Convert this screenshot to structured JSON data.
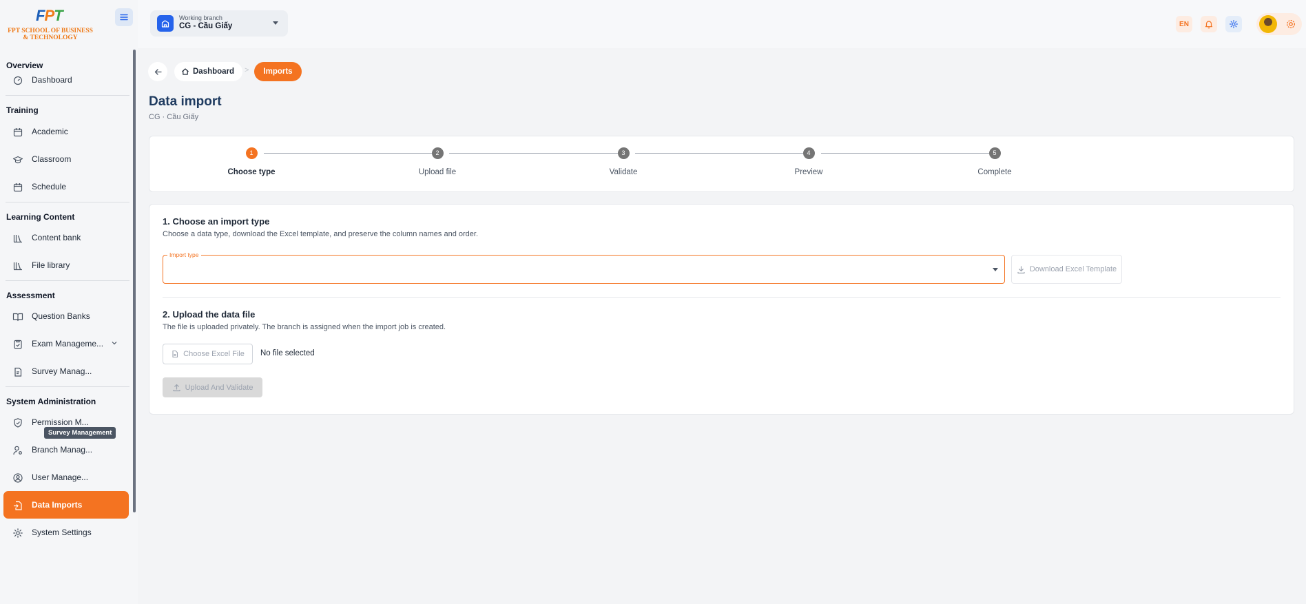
{
  "logo": {
    "mark_f": "F",
    "mark_p": "P",
    "mark_t": "T",
    "line1": "FPT SCHOOL OF BUSINESS",
    "line2": "& TECHNOLOGY"
  },
  "sidebar": {
    "sections": [
      {
        "title": "Overview",
        "items": [
          {
            "label": "Dashboard",
            "icon": "dashboard-icon"
          }
        ]
      },
      {
        "title": "Training",
        "items": [
          {
            "label": "Academic",
            "icon": "calendar-icon"
          },
          {
            "label": "Classroom",
            "icon": "graduation-cap-icon"
          },
          {
            "label": "Schedule",
            "icon": "calendar-icon"
          }
        ]
      },
      {
        "title": "Learning Content",
        "items": [
          {
            "label": "Content bank",
            "icon": "library-icon"
          },
          {
            "label": "File library",
            "icon": "library-icon"
          }
        ]
      },
      {
        "title": "Assessment",
        "items": [
          {
            "label": "Question Banks",
            "icon": "book-open-icon"
          },
          {
            "label": "Exam Manageme...",
            "icon": "clipboard-check-icon"
          },
          {
            "label": "Survey Manag...",
            "icon": "survey-icon"
          }
        ]
      },
      {
        "title": "System Administration",
        "items": [
          {
            "label": "Permission M...",
            "icon": "shield-icon"
          },
          {
            "label": "Branch Manag...",
            "icon": "user-cog-icon"
          },
          {
            "label": "User Manage...",
            "icon": "user-circle-icon"
          },
          {
            "label": "Data Imports",
            "icon": "file-import-icon"
          },
          {
            "label": "System Settings",
            "icon": "gear-icon"
          }
        ]
      }
    ],
    "active_item": "Data Imports",
    "tooltip": "Survey Management"
  },
  "header": {
    "branch_small": "Working branch",
    "branch_name": "CG - Cầu Giấy",
    "lang": "EN"
  },
  "breadcrumb": {
    "home": "Dashboard",
    "separator": ">",
    "current": "Imports"
  },
  "page": {
    "title": "Data import",
    "subtitle": "CG · Cầu Giấy"
  },
  "stepper": {
    "steps": [
      {
        "num": "1",
        "label": "Choose type"
      },
      {
        "num": "2",
        "label": "Upload file"
      },
      {
        "num": "3",
        "label": "Validate"
      },
      {
        "num": "4",
        "label": "Preview"
      },
      {
        "num": "5",
        "label": "Complete"
      }
    ],
    "active": 1
  },
  "import_type": {
    "title": "1. Choose an import type",
    "description": "Choose a data type, download the Excel template, and preserve the column names and order.",
    "field_label": "Import type",
    "value": "",
    "download_label": "Download Excel Template"
  },
  "upload": {
    "title": "2. Upload the data file",
    "description": "The file is uploaded privately. The branch is assigned when the import job is created.",
    "choose_label": "Choose Excel File",
    "no_file": "No file selected",
    "upload_label": "Upload And Validate"
  },
  "colors": {
    "accent": "#f47321",
    "primary": "#2563eb",
    "title": "#1e3a5f"
  }
}
